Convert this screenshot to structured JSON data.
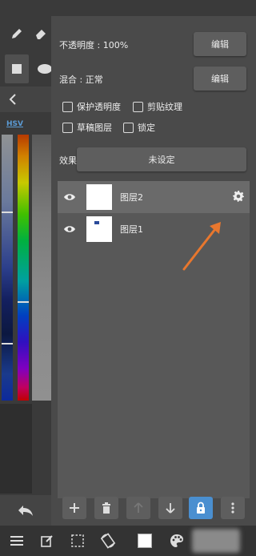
{
  "panel": {
    "opacity_label": "不透明度 : 100%",
    "opacity_edit": "编辑",
    "blend_label": "混合 : 正常",
    "blend_edit": "编辑",
    "checkboxes": [
      {
        "label": "保护透明度",
        "checked": false
      },
      {
        "label": "剪贴纹理",
        "checked": false
      },
      {
        "label": "草稿图层",
        "checked": false
      },
      {
        "label": "锁定",
        "checked": false
      }
    ],
    "effect_label": "效果",
    "effect_value": "未设定"
  },
  "left": {
    "color_mode": "HSV"
  },
  "layers": [
    {
      "name": "图层2",
      "selected": true,
      "visible": true
    },
    {
      "name": "图层1",
      "selected": false,
      "visible": true
    }
  ],
  "colors": {
    "accent": "#4a8fd0",
    "arrow": "#e8772e",
    "panel_bg": "#4a4a4a"
  },
  "icons": {
    "layer_actions": [
      "plus-icon",
      "trash-icon",
      "arrow-up-icon",
      "arrow-down-icon",
      "lock-icon",
      "more-vertical-icon"
    ],
    "bottom_bar": [
      "menu-icon",
      "edit-icon",
      "selection-icon",
      "rotate-icon",
      "color-swatch-icon",
      "palette-icon"
    ]
  }
}
